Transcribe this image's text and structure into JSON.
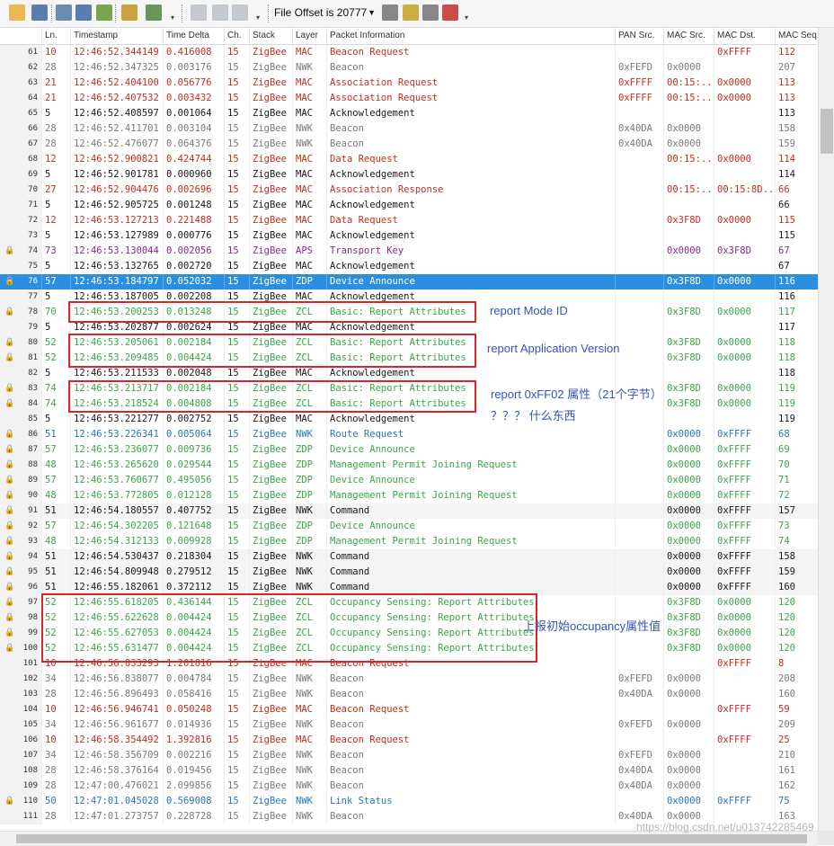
{
  "toolbar": {
    "file_offset_label": "File Offset is 20777",
    "buttons": [
      {
        "name": "open-file-icon",
        "color": "#e8b341"
      },
      {
        "name": "save-file-icon",
        "color": "#4a6fa8"
      },
      {
        "name": "columns-icon",
        "color": "#5b7fa6"
      },
      {
        "name": "packet-details-icon",
        "color": "#4a6fa8"
      },
      {
        "name": "export-icon",
        "color": "#6a9b3c"
      },
      {
        "name": "brush-icon",
        "color": "#c89a2a"
      },
      {
        "name": "gear-icon",
        "color": "#5b8a4a"
      },
      {
        "name": "copy-icon",
        "color": "#9aa4b0"
      },
      {
        "name": "previous-icon",
        "color": "#9aa4b0"
      },
      {
        "name": "next-icon",
        "color": "#9aa4b0"
      },
      {
        "name": "filter-icon",
        "color": "#7b7b7b"
      },
      {
        "name": "filter-yellow-icon",
        "color": "#c8a62a"
      },
      {
        "name": "filter-clear-icon",
        "color": "#7b7b7b"
      },
      {
        "name": "filter-red-icon",
        "color": "#c83a3a"
      }
    ]
  },
  "columns": [
    "Ln.",
    "Timestamp",
    "Time Delta",
    "Ch.",
    "Stack",
    "Layer",
    "Packet Information",
    "PAN Src.",
    "MAC Src.",
    "MAC Dst.",
    "MAC Seq."
  ],
  "colors": {
    "red": "#c0301f",
    "black": "#1a1a1a",
    "gray": "#7a7a7a",
    "green": "#3aa64a",
    "purple": "#8a2c8a",
    "blue": "#2c76b8",
    "selected_bg": "#2a8fe0",
    "selected_fg": "#ffffff"
  },
  "rows": [
    {
      "idx": "61",
      "ln": "10",
      "ts": "12:46:52.344149",
      "td": "0.416008",
      "ch": "15",
      "stack": "ZigBee",
      "layer": "MAC",
      "info": "Beacon Request",
      "pan": "",
      "msrc": "",
      "mdst": "0xFFFF",
      "mseq": "112",
      "color": "red"
    },
    {
      "idx": "62",
      "ln": "28",
      "ts": "12:46:52.347325",
      "td": "0.003176",
      "ch": "15",
      "stack": "ZigBee",
      "layer": "NWK",
      "info": "Beacon",
      "pan": "0xFEFD",
      "msrc": "0x0000",
      "mdst": "",
      "mseq": "207",
      "color": "gray"
    },
    {
      "idx": "63",
      "ln": "21",
      "ts": "12:46:52.404100",
      "td": "0.056776",
      "ch": "15",
      "stack": "ZigBee",
      "layer": "MAC",
      "info": "Association Request",
      "pan": "0xFFFF",
      "msrc": "00:15:..",
      "mdst": "0x0000",
      "mseq": "113",
      "color": "red"
    },
    {
      "idx": "64",
      "ln": "21",
      "ts": "12:46:52.407532",
      "td": "0.003432",
      "ch": "15",
      "stack": "ZigBee",
      "layer": "MAC",
      "info": "Association Request",
      "pan": "0xFFFF",
      "msrc": "00:15:..",
      "mdst": "0x0000",
      "mseq": "113",
      "color": "red"
    },
    {
      "idx": "65",
      "ln": "5",
      "ts": "12:46:52.408597",
      "td": "0.001064",
      "ch": "15",
      "stack": "ZigBee",
      "layer": "MAC",
      "info": "Acknowledgement",
      "pan": "",
      "msrc": "",
      "mdst": "",
      "mseq": "113",
      "color": "black"
    },
    {
      "idx": "66",
      "ln": "28",
      "ts": "12:46:52.411701",
      "td": "0.003104",
      "ch": "15",
      "stack": "ZigBee",
      "layer": "NWK",
      "info": "Beacon",
      "pan": "0x40DA",
      "msrc": "0x0000",
      "mdst": "",
      "mseq": "158",
      "color": "gray"
    },
    {
      "idx": "67",
      "ln": "28",
      "ts": "12:46:52.476077",
      "td": "0.064376",
      "ch": "15",
      "stack": "ZigBee",
      "layer": "NWK",
      "info": "Beacon",
      "pan": "0x40DA",
      "msrc": "0x0000",
      "mdst": "",
      "mseq": "159",
      "color": "gray"
    },
    {
      "idx": "68",
      "ln": "12",
      "ts": "12:46:52.900821",
      "td": "0.424744",
      "ch": "15",
      "stack": "ZigBee",
      "layer": "MAC",
      "info": "Data Request",
      "pan": "",
      "msrc": "00:15:..",
      "mdst": "0x0000",
      "mseq": "114",
      "color": "red"
    },
    {
      "idx": "69",
      "ln": "5",
      "ts": "12:46:52.901781",
      "td": "0.000960",
      "ch": "15",
      "stack": "ZigBee",
      "layer": "MAC",
      "info": "Acknowledgement",
      "pan": "",
      "msrc": "",
      "mdst": "",
      "mseq": "114",
      "color": "black"
    },
    {
      "idx": "70",
      "ln": "27",
      "ts": "12:46:52.904476",
      "td": "0.002696",
      "ch": "15",
      "stack": "ZigBee",
      "layer": "MAC",
      "info": "Association Response",
      "pan": "",
      "msrc": "00:15:..",
      "mdst": "00:15:8D...",
      "mseq": "66",
      "color": "red"
    },
    {
      "idx": "71",
      "ln": "5",
      "ts": "12:46:52.905725",
      "td": "0.001248",
      "ch": "15",
      "stack": "ZigBee",
      "layer": "MAC",
      "info": "Acknowledgement",
      "pan": "",
      "msrc": "",
      "mdst": "",
      "mseq": "66",
      "color": "black"
    },
    {
      "idx": "72",
      "ln": "12",
      "ts": "12:46:53.127213",
      "td": "0.221488",
      "ch": "15",
      "stack": "ZigBee",
      "layer": "MAC",
      "info": "Data Request",
      "pan": "",
      "msrc": "0x3F8D",
      "mdst": "0x0000",
      "mseq": "115",
      "color": "red"
    },
    {
      "idx": "73",
      "ln": "5",
      "ts": "12:46:53.127989",
      "td": "0.000776",
      "ch": "15",
      "stack": "ZigBee",
      "layer": "MAC",
      "info": "Acknowledgement",
      "pan": "",
      "msrc": "",
      "mdst": "",
      "mseq": "115",
      "color": "black"
    },
    {
      "idx": "74",
      "lock": true,
      "ln": "73",
      "ts": "12:46:53.130044",
      "td": "0.002056",
      "ch": "15",
      "stack": "ZigBee",
      "layer": "APS",
      "info": "Transport Key",
      "pan": "",
      "msrc": "0x0000",
      "mdst": "0x3F8D",
      "mseq": "67",
      "color": "purple"
    },
    {
      "idx": "75",
      "ln": "5",
      "ts": "12:46:53.132765",
      "td": "0.002720",
      "ch": "15",
      "stack": "ZigBee",
      "layer": "MAC",
      "info": "Acknowledgement",
      "pan": "",
      "msrc": "",
      "mdst": "",
      "mseq": "67",
      "color": "black"
    },
    {
      "idx": "76",
      "lock": true,
      "selected": true,
      "ln": "57",
      "ts": "12:46:53.184797",
      "td": "0.052032",
      "ch": "15",
      "stack": "ZigBee",
      "layer": "ZDP",
      "info": "Device Announce",
      "pan": "",
      "msrc": "0x3F8D",
      "mdst": "0x0000",
      "mseq": "116",
      "color": "black"
    },
    {
      "idx": "77",
      "ln": "5",
      "ts": "12:46:53.187005",
      "td": "0.002208",
      "ch": "15",
      "stack": "ZigBee",
      "layer": "MAC",
      "info": "Acknowledgement",
      "pan": "",
      "msrc": "",
      "mdst": "",
      "mseq": "116",
      "color": "black"
    },
    {
      "idx": "78",
      "lock": true,
      "ln": "70",
      "ts": "12:46:53.200253",
      "td": "0.013248",
      "ch": "15",
      "stack": "ZigBee",
      "layer": "ZCL",
      "info": "Basic: Report Attributes",
      "pan": "",
      "msrc": "0x3F8D",
      "mdst": "0x0000",
      "mseq": "117",
      "color": "green"
    },
    {
      "idx": "79",
      "ln": "5",
      "ts": "12:46:53.202877",
      "td": "0.002624",
      "ch": "15",
      "stack": "ZigBee",
      "layer": "MAC",
      "info": "Acknowledgement",
      "pan": "",
      "msrc": "",
      "mdst": "",
      "mseq": "117",
      "color": "black"
    },
    {
      "idx": "80",
      "lock": true,
      "ln": "52",
      "ts": "12:46:53.205061",
      "td": "0.002184",
      "ch": "15",
      "stack": "ZigBee",
      "layer": "ZCL",
      "info": "Basic: Report Attributes",
      "pan": "",
      "msrc": "0x3F8D",
      "mdst": "0x0000",
      "mseq": "118",
      "color": "green"
    },
    {
      "idx": "81",
      "lock": true,
      "ln": "52",
      "ts": "12:46:53.209485",
      "td": "0.004424",
      "ch": "15",
      "stack": "ZigBee",
      "layer": "ZCL",
      "info": "Basic: Report Attributes",
      "pan": "",
      "msrc": "0x3F8D",
      "mdst": "0x0000",
      "mseq": "118",
      "color": "green"
    },
    {
      "idx": "82",
      "ln": "5",
      "ts": "12:46:53.211533",
      "td": "0.002048",
      "ch": "15",
      "stack": "ZigBee",
      "layer": "MAC",
      "info": "Acknowledgement",
      "pan": "",
      "msrc": "",
      "mdst": "",
      "mseq": "118",
      "color": "black"
    },
    {
      "idx": "83",
      "lock": true,
      "ln": "74",
      "ts": "12:46:53.213717",
      "td": "0.002184",
      "ch": "15",
      "stack": "ZigBee",
      "layer": "ZCL",
      "info": "Basic: Report Attributes",
      "pan": "",
      "msrc": "0x3F8D",
      "mdst": "0x0000",
      "mseq": "119",
      "color": "green"
    },
    {
      "idx": "84",
      "lock": true,
      "ln": "74",
      "ts": "12:46:53.218524",
      "td": "0.004808",
      "ch": "15",
      "stack": "ZigBee",
      "layer": "ZCL",
      "info": "Basic: Report Attributes",
      "pan": "",
      "msrc": "0x3F8D",
      "mdst": "0x0000",
      "mseq": "119",
      "color": "green"
    },
    {
      "idx": "85",
      "ln": "5",
      "ts": "12:46:53.221277",
      "td": "0.002752",
      "ch": "15",
      "stack": "ZigBee",
      "layer": "MAC",
      "info": "Acknowledgement",
      "pan": "",
      "msrc": "",
      "mdst": "",
      "mseq": "119",
      "color": "black"
    },
    {
      "idx": "86",
      "lock": true,
      "ln": "51",
      "ts": "12:46:53.226341",
      "td": "0.005064",
      "ch": "15",
      "stack": "ZigBee",
      "layer": "NWK",
      "info": "Route Request",
      "pan": "",
      "msrc": "0x0000",
      "mdst": "0xFFFF",
      "mseq": "68",
      "color": "blue"
    },
    {
      "idx": "87",
      "lock": true,
      "ln": "57",
      "ts": "12:46:53.236077",
      "td": "0.009736",
      "ch": "15",
      "stack": "ZigBee",
      "layer": "ZDP",
      "info": "Device Announce",
      "pan": "",
      "msrc": "0x0000",
      "mdst": "0xFFFF",
      "mseq": "69",
      "color": "green"
    },
    {
      "idx": "88",
      "lock": true,
      "ln": "48",
      "ts": "12:46:53.265620",
      "td": "0.029544",
      "ch": "15",
      "stack": "ZigBee",
      "layer": "ZDP",
      "info": "Management Permit Joining Request",
      "pan": "",
      "msrc": "0x0000",
      "mdst": "0xFFFF",
      "mseq": "70",
      "color": "green"
    },
    {
      "idx": "89",
      "lock": true,
      "ln": "57",
      "ts": "12:46:53.760677",
      "td": "0.495056",
      "ch": "15",
      "stack": "ZigBee",
      "layer": "ZDP",
      "info": "Device Announce",
      "pan": "",
      "msrc": "0x0000",
      "mdst": "0xFFFF",
      "mseq": "71",
      "color": "green"
    },
    {
      "idx": "90",
      "lock": true,
      "ln": "48",
      "ts": "12:46:53.772805",
      "td": "0.012128",
      "ch": "15",
      "stack": "ZigBee",
      "layer": "ZDP",
      "info": "Management Permit Joining Request",
      "pan": "",
      "msrc": "0x0000",
      "mdst": "0xFFFF",
      "mseq": "72",
      "color": "green"
    },
    {
      "idx": "91",
      "lock": true,
      "ln": "51",
      "ts": "12:46:54.180557",
      "td": "0.407752",
      "ch": "15",
      "stack": "ZigBee",
      "layer": "NWK",
      "info": "Command",
      "pan": "",
      "msrc": "0x0000",
      "mdst": "0xFFFF",
      "mseq": "157",
      "color": "black",
      "shaded": true
    },
    {
      "idx": "92",
      "lock": true,
      "ln": "57",
      "ts": "12:46:54.302205",
      "td": "0.121648",
      "ch": "15",
      "stack": "ZigBee",
      "layer": "ZDP",
      "info": "Device Announce",
      "pan": "",
      "msrc": "0x0000",
      "mdst": "0xFFFF",
      "mseq": "73",
      "color": "green"
    },
    {
      "idx": "93",
      "lock": true,
      "ln": "48",
      "ts": "12:46:54.312133",
      "td": "0.009928",
      "ch": "15",
      "stack": "ZigBee",
      "layer": "ZDP",
      "info": "Management Permit Joining Request",
      "pan": "",
      "msrc": "0x0000",
      "mdst": "0xFFFF",
      "mseq": "74",
      "color": "green"
    },
    {
      "idx": "94",
      "lock": true,
      "ln": "51",
      "ts": "12:46:54.530437",
      "td": "0.218304",
      "ch": "15",
      "stack": "ZigBee",
      "layer": "NWK",
      "info": "Command",
      "pan": "",
      "msrc": "0x0000",
      "mdst": "0xFFFF",
      "mseq": "158",
      "color": "black",
      "shaded": true
    },
    {
      "idx": "95",
      "lock": true,
      "ln": "51",
      "ts": "12:46:54.809948",
      "td": "0.279512",
      "ch": "15",
      "stack": "ZigBee",
      "layer": "NWK",
      "info": "Command",
      "pan": "",
      "msrc": "0x0000",
      "mdst": "0xFFFF",
      "mseq": "159",
      "color": "black",
      "shaded": true
    },
    {
      "idx": "96",
      "lock": true,
      "ln": "51",
      "ts": "12:46:55.182061",
      "td": "0.372112",
      "ch": "15",
      "stack": "ZigBee",
      "layer": "NWK",
      "info": "Command",
      "pan": "",
      "msrc": "0x0000",
      "mdst": "0xFFFF",
      "mseq": "160",
      "color": "black",
      "shaded": true
    },
    {
      "idx": "97",
      "lock": true,
      "ln": "52",
      "ts": "12:46:55.618205",
      "td": "0.436144",
      "ch": "15",
      "stack": "ZigBee",
      "layer": "ZCL",
      "info": "Occupancy Sensing: Report Attributes",
      "pan": "",
      "msrc": "0x3F8D",
      "mdst": "0x0000",
      "mseq": "120",
      "color": "green"
    },
    {
      "idx": "98",
      "lock": true,
      "ln": "52",
      "ts": "12:46:55.622628",
      "td": "0.004424",
      "ch": "15",
      "stack": "ZigBee",
      "layer": "ZCL",
      "info": "Occupancy Sensing: Report Attributes",
      "pan": "",
      "msrc": "0x3F8D",
      "mdst": "0x0000",
      "mseq": "120",
      "color": "green"
    },
    {
      "idx": "99",
      "lock": true,
      "ln": "52",
      "ts": "12:46:55.627053",
      "td": "0.004424",
      "ch": "15",
      "stack": "ZigBee",
      "layer": "ZCL",
      "info": "Occupancy Sensing: Report Attributes",
      "pan": "",
      "msrc": "0x3F8D",
      "mdst": "0x0000",
      "mseq": "120",
      "color": "green"
    },
    {
      "idx": "100",
      "lock": true,
      "ln": "52",
      "ts": "12:46:55.631477",
      "td": "0.004424",
      "ch": "15",
      "stack": "ZigBee",
      "layer": "ZCL",
      "info": "Occupancy Sensing: Report Attributes",
      "pan": "",
      "msrc": "0x3F8D",
      "mdst": "0x0000",
      "mseq": "120",
      "color": "green"
    },
    {
      "idx": "101",
      "ln": "10",
      "ts": "12:46:56.833293",
      "td": "1.201816",
      "ch": "15",
      "stack": "ZigBee",
      "layer": "MAC",
      "info": "Beacon Request",
      "pan": "",
      "msrc": "",
      "mdst": "0xFFFF",
      "mseq": "8",
      "color": "red"
    },
    {
      "idx": "102",
      "ln": "34",
      "ts": "12:46:56.838077",
      "td": "0.004784",
      "ch": "15",
      "stack": "ZigBee",
      "layer": "NWK",
      "info": "Beacon",
      "pan": "0xFEFD",
      "msrc": "0x0000",
      "mdst": "",
      "mseq": "208",
      "color": "gray"
    },
    {
      "idx": "103",
      "ln": "28",
      "ts": "12:46:56.896493",
      "td": "0.058416",
      "ch": "15",
      "stack": "ZigBee",
      "layer": "NWK",
      "info": "Beacon",
      "pan": "0x40DA",
      "msrc": "0x0000",
      "mdst": "",
      "mseq": "160",
      "color": "gray"
    },
    {
      "idx": "104",
      "ln": "10",
      "ts": "12:46:56.946741",
      "td": "0.050248",
      "ch": "15",
      "stack": "ZigBee",
      "layer": "MAC",
      "info": "Beacon Request",
      "pan": "",
      "msrc": "",
      "mdst": "0xFFFF",
      "mseq": "59",
      "color": "red"
    },
    {
      "idx": "105",
      "ln": "34",
      "ts": "12:46:56.961677",
      "td": "0.014936",
      "ch": "15",
      "stack": "ZigBee",
      "layer": "NWK",
      "info": "Beacon",
      "pan": "0xFEFD",
      "msrc": "0x0000",
      "mdst": "",
      "mseq": "209",
      "color": "gray"
    },
    {
      "idx": "106",
      "ln": "10",
      "ts": "12:46:58.354492",
      "td": "1.392816",
      "ch": "15",
      "stack": "ZigBee",
      "layer": "MAC",
      "info": "Beacon Request",
      "pan": "",
      "msrc": "",
      "mdst": "0xFFFF",
      "mseq": "25",
      "color": "red"
    },
    {
      "idx": "107",
      "ln": "34",
      "ts": "12:46:58.356709",
      "td": "0.002216",
      "ch": "15",
      "stack": "ZigBee",
      "layer": "NWK",
      "info": "Beacon",
      "pan": "0xFEFD",
      "msrc": "0x0000",
      "mdst": "",
      "mseq": "210",
      "color": "gray"
    },
    {
      "idx": "108",
      "ln": "28",
      "ts": "12:46:58.376164",
      "td": "0.019456",
      "ch": "15",
      "stack": "ZigBee",
      "layer": "NWK",
      "info": "Beacon",
      "pan": "0x40DA",
      "msrc": "0x0000",
      "mdst": "",
      "mseq": "161",
      "color": "gray"
    },
    {
      "idx": "109",
      "ln": "28",
      "ts": "12:47:00.476021",
      "td": "2.099856",
      "ch": "15",
      "stack": "ZigBee",
      "layer": "NWK",
      "info": "Beacon",
      "pan": "0x40DA",
      "msrc": "0x0000",
      "mdst": "",
      "mseq": "162",
      "color": "gray"
    },
    {
      "idx": "110",
      "lock": true,
      "ln": "50",
      "ts": "12:47:01.045028",
      "td": "0.569008",
      "ch": "15",
      "stack": "ZigBee",
      "layer": "NWK",
      "info": "Link Status",
      "pan": "",
      "msrc": "0x0000",
      "mdst": "0xFFFF",
      "mseq": "75",
      "color": "blue"
    },
    {
      "idx": "111",
      "ln": "28",
      "ts": "12:47:01.273757",
      "td": "0.228728",
      "ch": "15",
      "stack": "ZigBee",
      "layer": "NWK",
      "info": "Beacon",
      "pan": "0x40DA",
      "msrc": "0x0000",
      "mdst": "",
      "mseq": "163",
      "color": "gray"
    }
  ],
  "annotations": {
    "mode_id": "report Mode ID",
    "app_version": "report Application Version",
    "ff02": "report 0xFF02 属性（21个字节）",
    "unknown": "？？？ 什么东西",
    "occupancy": "上报初始occupancy属性值"
  },
  "watermark": "https://blog.csdn.net/u013742285469"
}
